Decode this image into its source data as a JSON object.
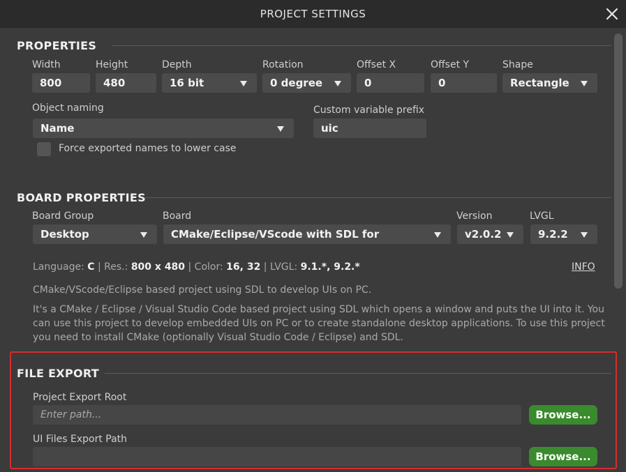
{
  "window": {
    "title": "PROJECT SETTINGS"
  },
  "properties": {
    "heading": "PROPERTIES",
    "width": {
      "label": "Width",
      "value": "800"
    },
    "height": {
      "label": "Height",
      "value": "480"
    },
    "depth": {
      "label": "Depth",
      "value": "16 bit"
    },
    "rotation": {
      "label": "Rotation",
      "value": "0 degree"
    },
    "offset_x": {
      "label": "Offset X",
      "value": "0"
    },
    "offset_y": {
      "label": "Offset Y",
      "value": "0"
    },
    "shape": {
      "label": "Shape",
      "value": "Rectangle"
    },
    "object_naming": {
      "label": "Object naming",
      "value": "Name"
    },
    "custom_prefix": {
      "label": "Custom variable prefix",
      "value": "uic"
    },
    "lowercase": {
      "label": "Force exported names to lower case",
      "checked": false
    }
  },
  "board": {
    "heading": "BOARD PROPERTIES",
    "group": {
      "label": "Board Group",
      "value": "Desktop"
    },
    "board": {
      "label": "Board",
      "value": "CMake/Eclipse/VScode with SDL for"
    },
    "version": {
      "label": "Version",
      "value": "v2.0.2"
    },
    "lvgl": {
      "label": "LVGL",
      "value": "9.2.2"
    },
    "info": {
      "language_label": "Language:",
      "language": "C",
      "res_label": "Res.:",
      "res": "800 x 480",
      "color_label": "Color:",
      "color": "16, 32",
      "lvgl_label": "LVGL:",
      "lvgl": "9.1.*, 9.2.*",
      "sep": "|",
      "link": "INFO"
    },
    "short_desc": "CMake/VScode/Eclipse based project using SDL to develop UIs on PC.",
    "long_desc": [
      "It's a CMake / Eclipse / Visual Studio Code based project using SDL which opens a window and puts the UI into it. You",
      "can use this project to develop embedded UIs on PC or to create standalone desktop applications. To use this project",
      "you need to install CMake (optionally Visual Studio Code / Eclipse) and SDL."
    ]
  },
  "file_export": {
    "heading": "FILE EXPORT",
    "export_root": {
      "label": "Project Export Root",
      "placeholder": "Enter path...",
      "value": ""
    },
    "ui_files_path": {
      "label": "UI Files Export Path",
      "placeholder": "",
      "value": ""
    },
    "browse_label": "Browse..."
  },
  "colors": {
    "accent_green": "#3a8a2e",
    "highlight_red": "#d62d2d",
    "panel": "#3b3b3b"
  }
}
